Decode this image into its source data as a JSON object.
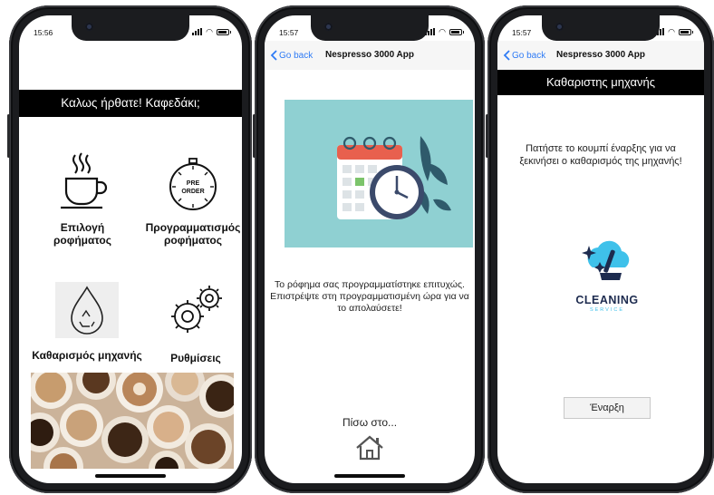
{
  "screen1": {
    "status_time": "15:56",
    "welcome": "Καλως ήρθατε! Καφεδάκι;",
    "tiles": [
      {
        "label": "Επιλογή ροφήματος",
        "icon": "coffee-cup-icon"
      },
      {
        "label": "Προγραμματισμός ροφήματος",
        "icon": "pre-order-timer-icon",
        "badge_line1": "PRE",
        "badge_line2": "ORDER"
      },
      {
        "label": "Καθαρισμός μηχανής",
        "icon": "water-drop-recycle-icon"
      },
      {
        "label": "Ρυθμίσεις",
        "icon": "gears-icon"
      }
    ],
    "photo": "coffee-cups-photo"
  },
  "screen2": {
    "status_time": "15:57",
    "back_label": "Go back",
    "title": "Nespresso 3000 App",
    "message": "Το ρόφημα σας προγραμματίστηκε επιτυχώς. Επιστρέψτε στη προγραμματισμένη ώρα για να το απολαύσετε!",
    "back_to_label": "Πίσω στο...",
    "home_icon": "home-icon",
    "illustration": "calendar-clock-illustration"
  },
  "screen3": {
    "status_time": "15:57",
    "back_label": "Go back",
    "title": "Nespresso 3000 App",
    "header": "Καθαριστης μηχανής",
    "instruction": "Πατήστε το κουμπί έναρξης για να ξεκινήσει ο καθαρισμός της μηχανής!",
    "logo_text": "CLEANING",
    "logo_subtext": "SERVICE",
    "start_label": "Έναρξη"
  },
  "colors": {
    "header_bg": "#000000",
    "link_blue": "#2f7bf5",
    "illustration_bg": "#8fd0d2",
    "logo_navy": "#1d2b4f",
    "logo_cyan": "#3fc1ea"
  }
}
